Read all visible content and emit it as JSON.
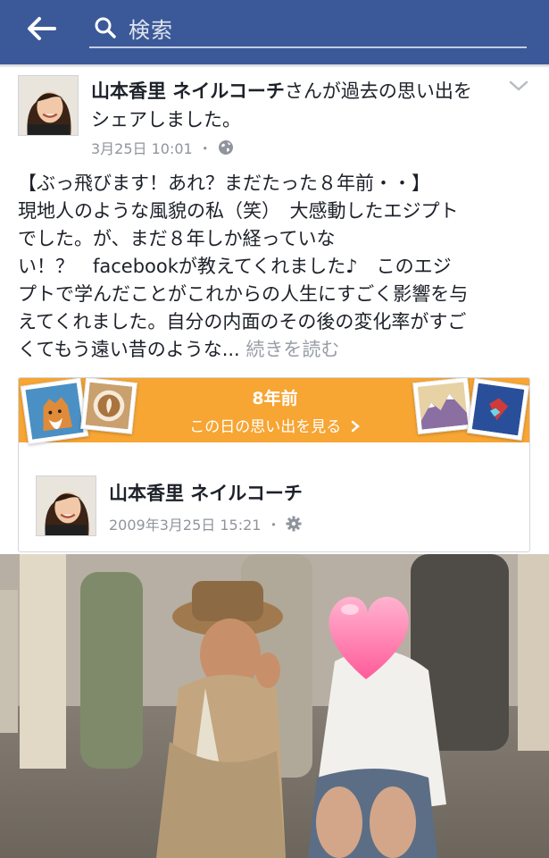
{
  "topbar": {
    "back_icon": "arrow-left-icon",
    "search_icon": "search-icon",
    "search_placeholder": "検索",
    "color": "#3b5998"
  },
  "post": {
    "author": "山本香里 ネイルコーチ",
    "action": "さんが過去の思い出をシェアしました。",
    "timestamp": "3月25日 10:01",
    "separator": "・",
    "privacy_icon": "globe-icon",
    "menu_icon": "chevron-down-icon",
    "body_lines": [
      "【ぶっ飛びます！あれ？まだたった８年前・・】",
      "現地人のような風貌の私（笑）　大感動したエジプト",
      "でした。が、まだ８年しか経っていな",
      "い！？　facebookが教えてくれました♪　このエジ",
      "プトで学んだことがこれからの人生にすごく影響を与",
      "えてくれました。自分の内面のその後の変化率がすご"
    ],
    "body_last_line": "くてもう遠い昔のような...",
    "read_more": "続きを読む"
  },
  "memory": {
    "years_ago": "8年前",
    "see_memories": "この日の思い出を見る",
    "see_icon": "chevron-right-icon",
    "banner_color": "#f7a533",
    "shared_post": {
      "author": "山本香里 ネイルコーチ",
      "timestamp": "2009年3月25日 15:21",
      "separator": "・",
      "settings_icon": "gear-icon"
    }
  }
}
